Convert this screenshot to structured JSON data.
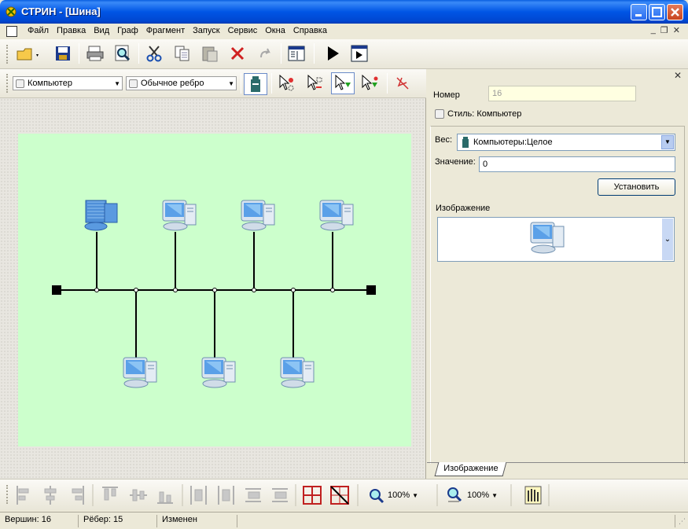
{
  "window": {
    "title": "СТРИН - [Шина]"
  },
  "menu": {
    "items": [
      "Файл",
      "Правка",
      "Вид",
      "Граф",
      "Фрагмент",
      "Запуск",
      "Сервис",
      "Окна",
      "Справка"
    ]
  },
  "toolbar2": {
    "vertex_type": "Компьютер",
    "edge_type": "Обычное ребро"
  },
  "panel": {
    "number_label": "Номер",
    "number_value": "16",
    "style_label": "Стиль: Компьютер",
    "weight_label": "Вес:",
    "weight_value": "Компьютеры:Целое",
    "value_label": "Значение:",
    "value_value": "0",
    "set_button": "Установить",
    "image_label": "Изображение",
    "tab_label": "Изображение"
  },
  "bottom": {
    "zoom1": "100%",
    "zoom2": "100%"
  },
  "status": {
    "vertices": "Вершин: 16",
    "edges": "Рёбер: 15",
    "state": "Изменен"
  },
  "colors": {
    "canvas_bg": "#ccffcc",
    "titlebar": "#0055e5"
  },
  "icons": [
    "open-folder-icon",
    "save-icon",
    "print-icon",
    "preview-icon",
    "cut-icon",
    "copy-icon",
    "paste-icon",
    "delete-icon",
    "undo-icon",
    "properties-icon",
    "run-icon",
    "stop-icon"
  ]
}
